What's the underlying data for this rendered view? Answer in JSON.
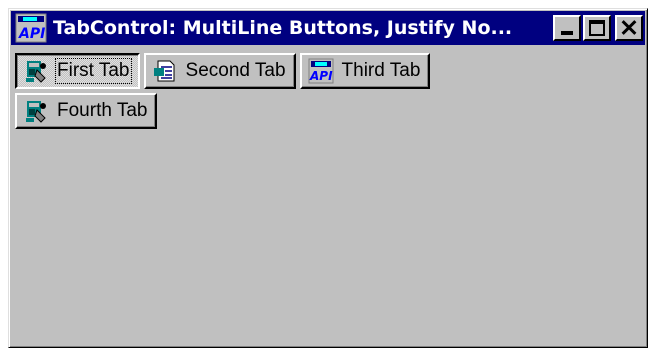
{
  "window": {
    "title": "TabControl: MultiLine Buttons, Justify No...",
    "app_icon": "api-icon"
  },
  "title_buttons": {
    "minimize": "minimize-icon",
    "maximize": "maximize-icon",
    "close": "close-icon"
  },
  "tabs": [
    {
      "label": "First Tab",
      "icon": "gear-person-icon",
      "selected": true
    },
    {
      "label": "Second Tab",
      "icon": "document-icon",
      "selected": false
    },
    {
      "label": "Third Tab",
      "icon": "api-icon",
      "selected": false
    },
    {
      "label": "Fourth Tab",
      "icon": "gear-person-icon",
      "selected": false
    }
  ],
  "colors": {
    "titlebar": "#000080",
    "face": "#c0c0c0"
  }
}
